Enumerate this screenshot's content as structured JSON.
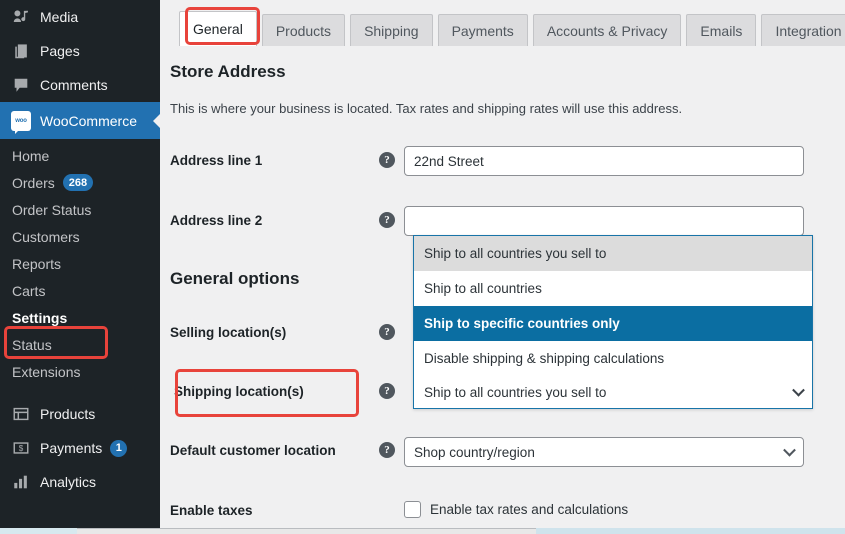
{
  "sidebar": {
    "top_items": [
      {
        "label": "Media",
        "icon": "media-icon"
      },
      {
        "label": "Pages",
        "icon": "pages-icon"
      },
      {
        "label": "Comments",
        "icon": "comments-icon"
      }
    ],
    "current_item": {
      "label": "WooCommerce",
      "icon": "woocommerce-logo-icon"
    },
    "submenu": [
      {
        "label": "Home",
        "badge": ""
      },
      {
        "label": "Orders",
        "badge": "268"
      },
      {
        "label": "Order Status",
        "badge": ""
      },
      {
        "label": "Customers",
        "badge": ""
      },
      {
        "label": "Reports",
        "badge": ""
      },
      {
        "label": "Carts",
        "badge": ""
      },
      {
        "label": "Settings",
        "badge": "",
        "active": true
      },
      {
        "label": "Status",
        "badge": ""
      },
      {
        "label": "Extensions",
        "badge": ""
      }
    ],
    "bottom_items": [
      {
        "label": "Products",
        "icon": "products-icon",
        "badge": ""
      },
      {
        "label": "Payments",
        "icon": "payments-icon",
        "badge": "1"
      },
      {
        "label": "Analytics",
        "icon": "analytics-icon",
        "badge": ""
      }
    ]
  },
  "tabs": [
    {
      "label": "General",
      "active": true
    },
    {
      "label": "Products",
      "active": false
    },
    {
      "label": "Shipping",
      "active": false
    },
    {
      "label": "Payments",
      "active": false
    },
    {
      "label": "Accounts & Privacy",
      "active": false
    },
    {
      "label": "Emails",
      "active": false
    },
    {
      "label": "Integration",
      "active": false
    }
  ],
  "store_address": {
    "title": "Store Address",
    "description": "This is where your business is located. Tax rates and shipping rates will use this address.",
    "address_line_1_label": "Address line 1",
    "address_line_1_value": "22nd Street",
    "address_line_2_label": "Address line 2",
    "address_line_2_value": "",
    "help_glyph": "?"
  },
  "general_options": {
    "title": "General options",
    "selling_location_label": "Selling location(s)",
    "shipping_location_label": "Shipping location(s)",
    "default_customer_location_label": "Default customer location",
    "default_customer_location_value": "Shop country/region",
    "enable_taxes_label": "Enable taxes",
    "enable_taxes_checkbox_label": "Enable tax rates and calculations"
  },
  "shipping_dropdown": {
    "current_value": "Ship to all countries you sell to",
    "options": [
      {
        "label": "Ship to all countries you sell to",
        "state": "hover"
      },
      {
        "label": "Ship to all countries",
        "state": "normal"
      },
      {
        "label": "Ship to specific countries only",
        "state": "selected"
      },
      {
        "label": "Disable shipping & shipping calculations",
        "state": "normal"
      }
    ]
  },
  "colors": {
    "accent_blue": "#2271b1",
    "dropdown_selected": "#0b6ea2",
    "annotation_red": "#e8433b",
    "sidebar_bg": "#1d2327",
    "page_bg": "#f0f0f1"
  }
}
